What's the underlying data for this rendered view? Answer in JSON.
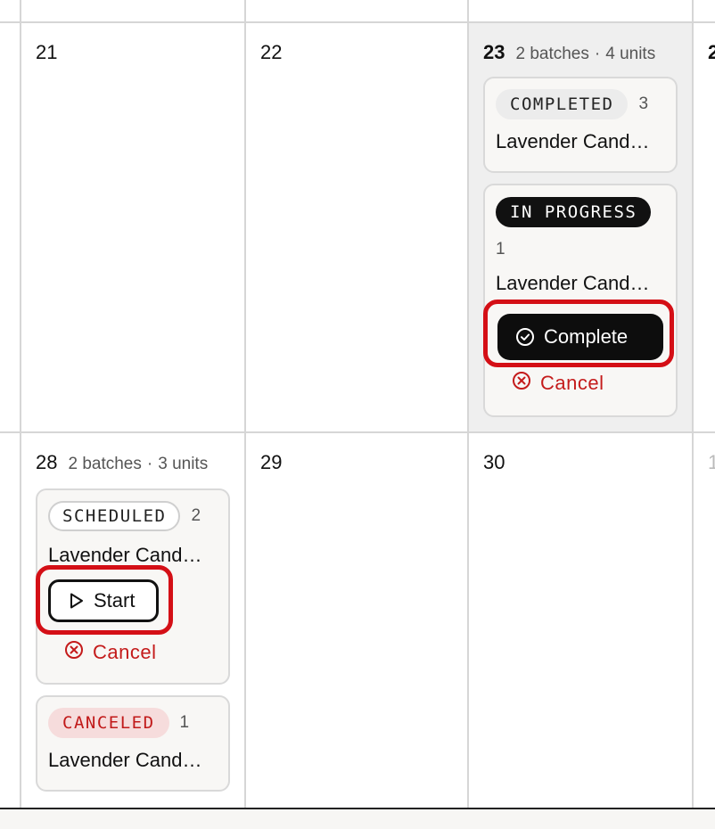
{
  "week1": [
    {
      "day": "21"
    },
    {
      "day": "22"
    },
    {
      "day": "23",
      "batches": "2 batches",
      "units": "4 units",
      "cards": [
        {
          "status": "COMPLETED",
          "qty": "3",
          "title": "Lavender Cand…"
        },
        {
          "status": "IN PROGRESS",
          "qty": "1",
          "title": "Lavender Cand…",
          "primary_action": "Complete",
          "cancel_action": "Cancel"
        }
      ]
    },
    {
      "day": "2"
    }
  ],
  "week2": [
    {
      "day": "28",
      "batches": "2 batches",
      "units": "3 units",
      "cards": [
        {
          "status": "SCHEDULED",
          "qty": "2",
          "title": "Lavender Cand…",
          "primary_action": "Start",
          "cancel_action": "Cancel"
        },
        {
          "status": "CANCELED",
          "qty": "1",
          "title": "Lavender Cand…"
        }
      ]
    },
    {
      "day": "29"
    },
    {
      "day": "30"
    },
    {
      "day": "1"
    }
  ],
  "meta_separator": "·",
  "colors": {
    "accent_red": "#c41b1b",
    "highlight_red": "#d40f16",
    "dark": "#111111",
    "today_bg": "#efefef"
  },
  "icons": {
    "complete": "check-circle-icon",
    "start": "play-icon",
    "cancel": "x-circle-icon"
  }
}
